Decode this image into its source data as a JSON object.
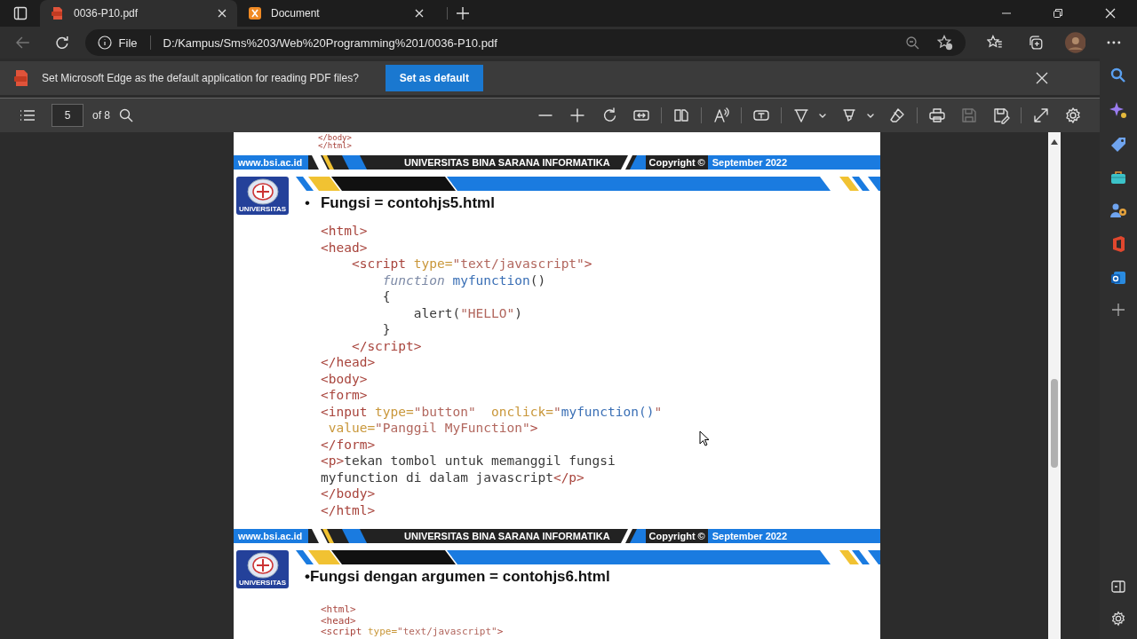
{
  "tabs": [
    {
      "title": "0036-P10.pdf",
      "selected": true
    },
    {
      "title": "Document",
      "selected": false
    }
  ],
  "address": {
    "scheme": "File",
    "url": "D:/Kampus/Sms%203/Web%20Programming%201/0036-P10.pdf"
  },
  "infobar": {
    "message": "Set Microsoft Edge as the default application for reading PDF files?",
    "button": "Set as default"
  },
  "pdf_toolbar": {
    "page": "5",
    "page_count": "of 8",
    "save_disabled": true
  },
  "document": {
    "top_code": [
      [
        {
          "kind": "tag",
          "text": "</body>"
        }
      ],
      [
        {
          "kind": "tag",
          "text": "</html>"
        }
      ]
    ],
    "footers": [
      {
        "url": "www.bsi.ac.id",
        "university": "UNIVERSITAS BINA SARANA INFORMATIKA",
        "copyright": "Copyright ©",
        "date": "September 2022"
      },
      {
        "url": "www.bsi.ac.id",
        "university": "UNIVERSITAS BINA SARANA INFORMATIKA",
        "copyright": "Copyright ©",
        "date": "September 2022"
      }
    ],
    "slides": [
      {
        "logo_label": "UNIVERSITAS",
        "bullet": "•",
        "title": "Fungsi = contohjs5.html",
        "kind": "full",
        "code": [
          [
            {
              "kind": "tag",
              "text": "<html>"
            }
          ],
          [
            {
              "kind": "tag",
              "text": "<head>"
            }
          ],
          [
            {
              "kind": "tag",
              "text": "    <script"
            },
            {
              "kind": "attr",
              "text": " type="
            },
            {
              "kind": "str",
              "text": "\"text/javascript\""
            },
            {
              "kind": "tag",
              "text": ">"
            }
          ],
          [
            {
              "kind": "kw",
              "text": "        function"
            },
            {
              "kind": "fn",
              "text": " myfunction"
            },
            {
              "kind": "plain",
              "text": "()"
            }
          ],
          [
            {
              "kind": "plain",
              "text": "        {"
            }
          ],
          [
            {
              "kind": "plain",
              "text": "            alert("
            },
            {
              "kind": "str",
              "text": "\"HELLO\""
            },
            {
              "kind": "plain",
              "text": ")"
            }
          ],
          [
            {
              "kind": "plain",
              "text": "        }"
            }
          ],
          [
            {
              "kind": "tag",
              "text": "    </script>"
            }
          ],
          [
            {
              "kind": "tag",
              "text": "</head>"
            }
          ],
          [
            {
              "kind": "tag",
              "text": "<body>"
            }
          ],
          [
            {
              "kind": "tag",
              "text": "<form>"
            }
          ],
          [
            {
              "kind": "tag",
              "text": "<input"
            },
            {
              "kind": "attr",
              "text": " type="
            },
            {
              "kind": "str",
              "text": "\"button\""
            },
            {
              "kind": "attr",
              "text": "  onclick="
            },
            {
              "kind": "str",
              "text": "\""
            },
            {
              "kind": "fn",
              "text": "myfunction()"
            },
            {
              "kind": "str",
              "text": "\""
            }
          ],
          [
            {
              "kind": "attr",
              "text": " value="
            },
            {
              "kind": "str",
              "text": "\"Panggil MyFunction\""
            },
            {
              "kind": "tag",
              "text": ">"
            }
          ],
          [
            {
              "kind": "tag",
              "text": "</form>"
            }
          ],
          [
            {
              "kind": "tag",
              "text": "<p>"
            },
            {
              "kind": "plain",
              "text": "tekan tombol untuk memanggil fungsi"
            }
          ],
          [
            {
              "kind": "plain",
              "text": "myfunction di dalam javascript"
            },
            {
              "kind": "tag",
              "text": "</p>"
            }
          ],
          [
            {
              "kind": "tag",
              "text": "</body>"
            }
          ],
          [
            {
              "kind": "tag",
              "text": "</html>"
            }
          ]
        ]
      },
      {
        "logo_label": "UNIVERSITAS",
        "title": "•Fungsi dengan argumen = contohjs6.html",
        "kind": "compact",
        "code": [
          [
            {
              "kind": "tag",
              "text": "<html>"
            }
          ],
          [
            {
              "kind": "tag",
              "text": "<head>"
            }
          ],
          [
            {
              "kind": "tag",
              "text": "<script"
            },
            {
              "kind": "attr",
              "text": " type="
            },
            {
              "kind": "str",
              "text": "\"text/javascript\""
            },
            {
              "kind": "tag",
              "text": ">"
            }
          ]
        ]
      }
    ]
  }
}
